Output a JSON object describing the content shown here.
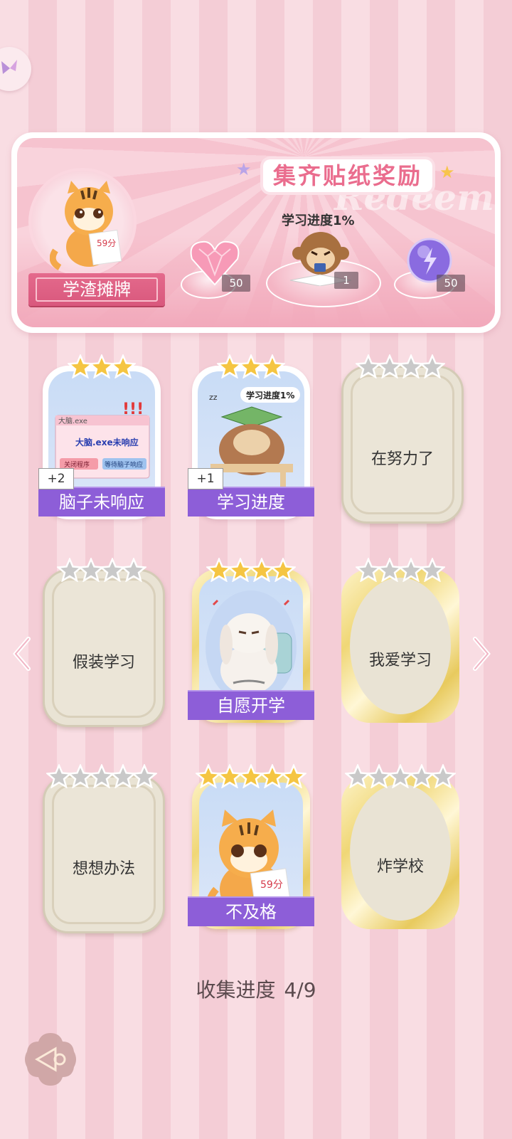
{
  "banner": {
    "title": "集齐贴纸奖励",
    "watermark": "Redeem",
    "character_title": "学渣摊牌",
    "tiger_paper_text": "59分",
    "rewards": [
      {
        "icon": "pink-heart-gem-icon",
        "count": "50"
      },
      {
        "icon": "monkey-sticker",
        "caption": "学习进度1%",
        "count": "1"
      },
      {
        "icon": "purple-lightning-orb-icon",
        "count": "50"
      }
    ]
  },
  "cards": [
    {
      "name": "脑子未响应",
      "state": "obtained",
      "stars": 3,
      "max_stars": 3,
      "badge": "+2",
      "art": {
        "window_title": "大脑.exe",
        "message": "大脑.exe未响应",
        "btn1": "关闭程序",
        "btn2": "等待脑子响应",
        "exclaim": "!!!"
      }
    },
    {
      "name": "学习进度",
      "state": "obtained",
      "stars": 3,
      "max_stars": 3,
      "badge": "+1",
      "art": {
        "bubble": "学习进度1%",
        "zz": "zz"
      }
    },
    {
      "name": "在努力了",
      "state": "locked",
      "stars": 0,
      "max_stars": 4
    },
    {
      "name": "假装学习",
      "state": "locked",
      "stars": 0,
      "max_stars": 4
    },
    {
      "name": "自愿开学",
      "state": "obtained-gold",
      "stars": 4,
      "max_stars": 4
    },
    {
      "name": "我爱学习",
      "state": "locked-gold",
      "stars": 0,
      "max_stars": 4
    },
    {
      "name": "想想办法",
      "state": "locked",
      "stars": 0,
      "max_stars": 5
    },
    {
      "name": "不及格",
      "state": "obtained-gold",
      "stars": 5,
      "max_stars": 5,
      "art": {
        "paper_text": "59分"
      }
    },
    {
      "name": "炸学校",
      "state": "locked-gold",
      "stars": 0,
      "max_stars": 5
    }
  ],
  "collection": {
    "label": "收集进度",
    "value": "4/9"
  },
  "colors": {
    "accent_pink": "#ea6d8e",
    "banner_purple": "#8d5ed8",
    "star_gold": "#f5c542",
    "star_grey": "#c9c9c9"
  }
}
